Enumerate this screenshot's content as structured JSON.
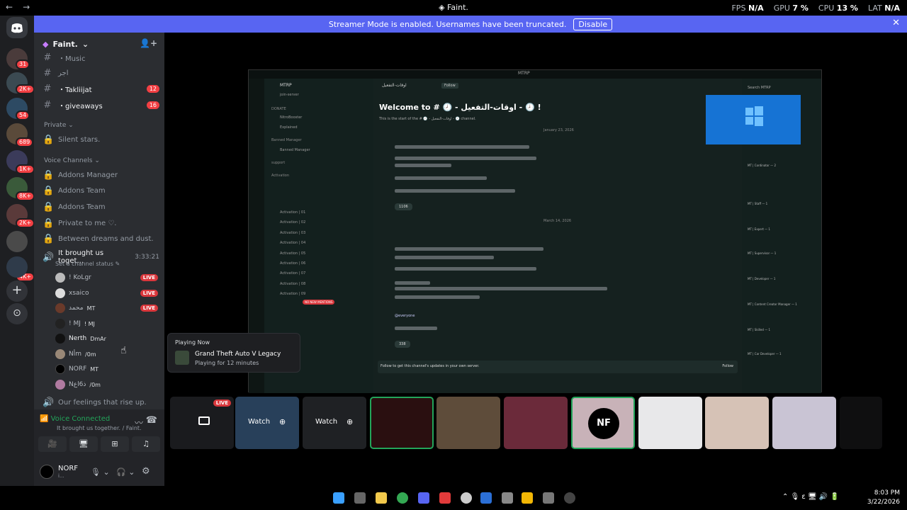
{
  "titlebar": {
    "title": "Faint.",
    "fps_label": "FPS",
    "fps_value": "N/A",
    "gpu_label": "GPU",
    "gpu_value": "7 %",
    "cpu_label": "CPU",
    "cpu_value": "13 %",
    "lat_label": "LAT",
    "lat_value": "N/A"
  },
  "banner": {
    "text": "Streamer Mode is enabled. Usernames have been truncated.",
    "button": "Disable"
  },
  "guilds": {
    "badges": [
      "31",
      "2K+",
      "54",
      "689",
      "1K+",
      "8K+",
      "2K+",
      "4K+"
    ]
  },
  "server": {
    "name": "Faint."
  },
  "channels": [
    {
      "name": "・Music",
      "badge": null
    },
    {
      "name": "اجر",
      "badge": null
    },
    {
      "name": "・Takliijat",
      "badge": "12"
    },
    {
      "name": "・giveaways",
      "badge": "16"
    }
  ],
  "private_category": "Private",
  "private_channels": [
    "Silent stars."
  ],
  "voice_category": "Voice Channels",
  "voice_channels": [
    "Addons Manager",
    "Addons Team",
    "Addons Team",
    "Private to me ♡.",
    "Between dreams and dust."
  ],
  "active_voice": {
    "name": "It brought us toget...",
    "timer": "3:33:21",
    "status_placeholder": "Set a channel status"
  },
  "voice_users": [
    {
      "name": "! KoLgr",
      "tag": "",
      "live": "LIVE"
    },
    {
      "name": "xsaico",
      "tag": "",
      "live": "LIVE"
    },
    {
      "name": "ﻣﺤﻤﺪ",
      "tag": "MT",
      "live": "LIVE"
    },
    {
      "name": "! MJ",
      "tag": "! MJ",
      "live": ""
    },
    {
      "name": "Nerth",
      "tag": "DmAr",
      "live": ""
    },
    {
      "name": "Nأm",
      "tag": "/0m",
      "live": ""
    },
    {
      "name": "NORF",
      "tag": "MT",
      "live": ""
    },
    {
      "name": "Nعlذ6",
      "tag": "/0m",
      "live": ""
    }
  ],
  "next_voice": "Our feelings that rise up.",
  "voice_panel": {
    "status": "Voice Connected",
    "channel": "It brought us together. / Faint."
  },
  "user": {
    "name": "NORF",
    "status": "i..."
  },
  "tooltip": {
    "header": "Playing Now",
    "game": "Grand Theft Auto V Legacy",
    "duration": "Playing for 12 minutes"
  },
  "stream": {
    "server_name": "MTRP",
    "channel_header": "اوقات-التفعيل",
    "follow": "Follow",
    "welcome": "Welcome to # 🕗 - اوقات-التفعيل - 🕗 !",
    "welcome_sub": "This is the start of the # 🕗 - اوقات-التفعيل - 🕗 channel.",
    "date1": "January 23, 2026",
    "date2": "March 14, 2026",
    "reaction1": "1106",
    "reaction2": "338",
    "mention": "@everyone",
    "footer_text": "Follow to get this channel's updates in your own server.",
    "footer_button": "Follow",
    "sidebar_channels": [
      "join-server",
      "NitroBooster",
      "Explained",
      "Banned Manager",
      "Activation | 01",
      "Activation | 02",
      "Activation | 03",
      "Activation | 04",
      "Activation | 05",
      "Activation | 06",
      "Activation | 07",
      "Activation | 08",
      "Activation | 09"
    ],
    "sidebar_categories": [
      "DONATE",
      "Banned Manager",
      "support",
      "Activation"
    ],
    "mentions_pill": "NO NEW MENTIONS",
    "members": [
      "MT | Cordinator — 2",
      "MT | Staff — 1",
      "MT | Expert — 1",
      "MT | Supervisor — 1",
      "MT | Developer — 1",
      "MT | Content Creator Manager — 1",
      "MT | Skilled — 1",
      "MT | Car Developer — 1"
    ],
    "search": "Search MTRP"
  },
  "thumbs": {
    "watch": "Watch",
    "live": "LIVE",
    "nf": "NF"
  },
  "clock": {
    "time": "8:03 PM",
    "date": "3/22/2026"
  }
}
